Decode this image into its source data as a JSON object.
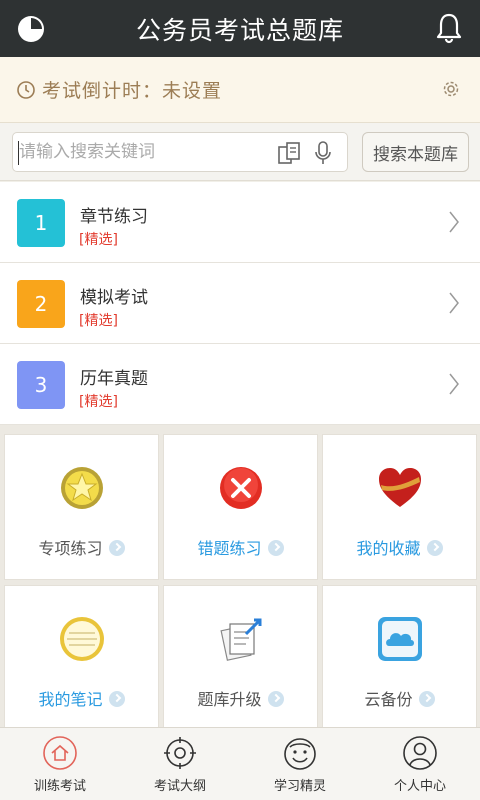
{
  "header": {
    "title": "公务员考试总题库"
  },
  "countdown": {
    "text": "考试倒计时：未设置"
  },
  "search": {
    "placeholder": "请输入搜索关键词",
    "value": "",
    "button_label": "搜索本题库"
  },
  "list": {
    "items": [
      {
        "number": "1",
        "label": "章节练习",
        "tag": "[精选]",
        "color": "#24c1d6"
      },
      {
        "number": "2",
        "label": "模拟考试",
        "tag": "[精选]",
        "color": "#f9a51b"
      },
      {
        "number": "3",
        "label": "历年真题",
        "tag": "[精选]",
        "color": "#7f95f4"
      }
    ]
  },
  "grid": {
    "tiles": [
      {
        "label": "专项练习",
        "icon": "star-badge-icon",
        "label_color": "#555555"
      },
      {
        "label": "错题练习",
        "icon": "red-x-icon",
        "label_color": "#2a9ae0"
      },
      {
        "label": "我的收藏",
        "icon": "heart-icon",
        "label_color": "#2a9ae0"
      },
      {
        "label": "我的笔记",
        "icon": "notepad-icon",
        "label_color": "#2a9ae0"
      },
      {
        "label": "题库升级",
        "icon": "upgrade-docs-icon",
        "label_color": "#555555"
      },
      {
        "label": "云备份",
        "icon": "cloud-icon",
        "label_color": "#555555"
      }
    ]
  },
  "bottom_nav": {
    "items": [
      {
        "label": "训练考试",
        "icon": "home-icon",
        "active": true
      },
      {
        "label": "考试大纲",
        "icon": "compass-icon",
        "active": false
      },
      {
        "label": "学习精灵",
        "icon": "smiley-icon",
        "active": false
      },
      {
        "label": "个人中心",
        "icon": "person-icon",
        "active": false
      }
    ]
  },
  "colors": {
    "header_bg": "#2e3233",
    "accent_blue": "#2a9ae0",
    "tag_red": "#e23b2e",
    "active_nav": "#e2645a"
  }
}
